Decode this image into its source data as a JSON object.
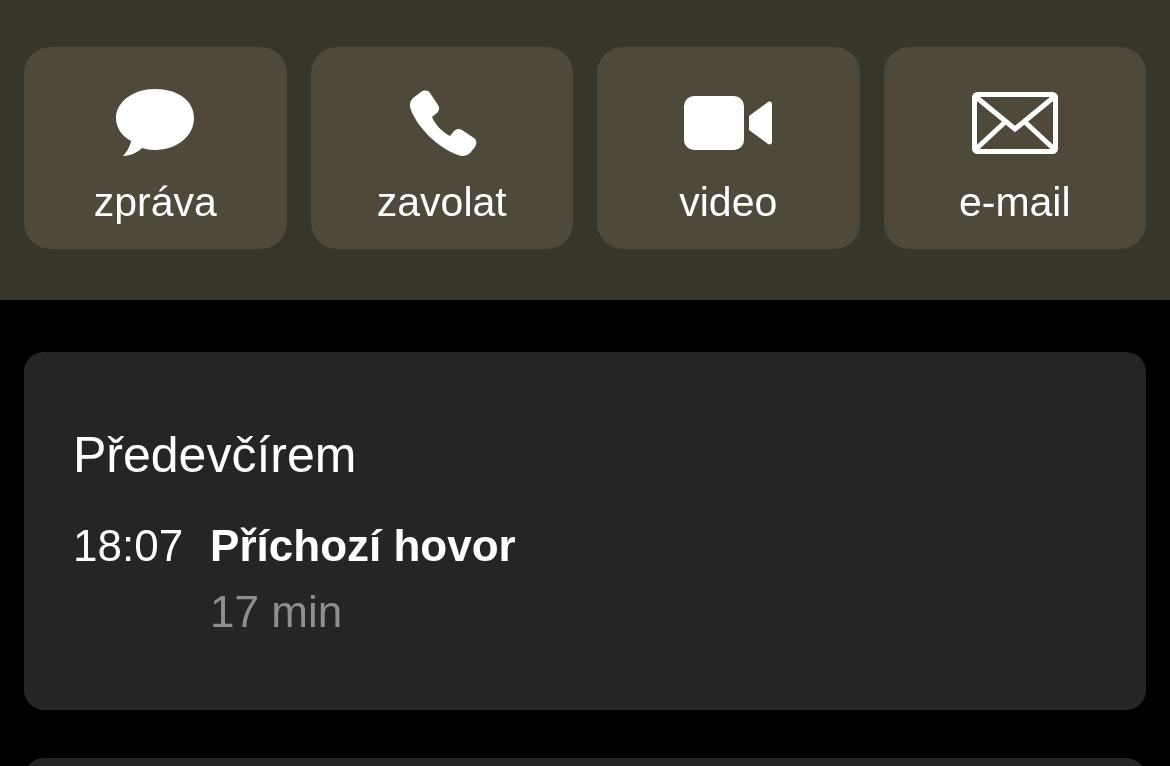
{
  "actions": [
    {
      "kind": "message",
      "label": "zpráva"
    },
    {
      "kind": "call",
      "label": "zavolat"
    },
    {
      "kind": "video",
      "label": "video"
    },
    {
      "kind": "mail",
      "label": "e-mail"
    }
  ],
  "recents": {
    "heading": "Předevčírem",
    "entries": [
      {
        "time": "18:07",
        "title": "Příchozí hovor",
        "duration": "17 min"
      }
    ]
  }
}
